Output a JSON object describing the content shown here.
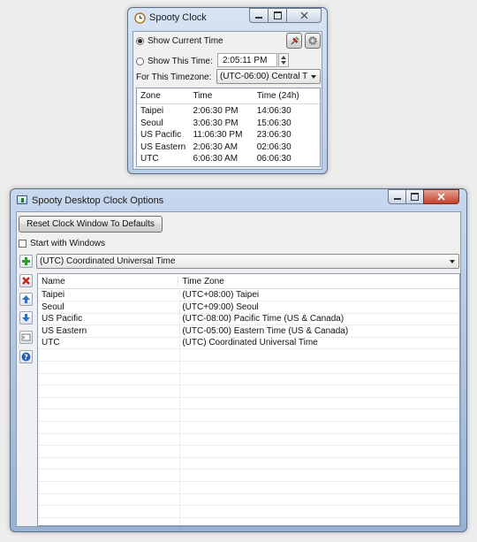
{
  "clock_window": {
    "title": "Spooty Clock",
    "show_current_time_label": "Show Current Time",
    "show_this_time_label": "Show This Time:",
    "this_time_value": "2:05:11 PM",
    "timezone_label": "For This Timezone:",
    "timezone_value": "(UTC-06:00) Central T",
    "pin_icon": "pin-icon",
    "settings_icon": "gear-icon",
    "columns": [
      "Zone",
      "Time",
      "Time (24h)"
    ],
    "rows": [
      {
        "zone": "Taipei",
        "time": "2:06:30 PM",
        "time24": "14:06:30"
      },
      {
        "zone": "Seoul",
        "time": "3:06:30 PM",
        "time24": "15:06:30"
      },
      {
        "zone": "US Pacific",
        "time": "11:06:30 PM",
        "time24": "23:06:30"
      },
      {
        "zone": "US Eastern",
        "time": "2:06:30 AM",
        "time24": "02:06:30"
      },
      {
        "zone": "UTC",
        "time": "6:06:30 AM",
        "time24": "06:06:30"
      }
    ]
  },
  "options_window": {
    "title": "Spooty Desktop Clock Options",
    "reset_button_label": "Reset Clock Window To Defaults",
    "start_with_windows_label": "Start with Windows",
    "timezone_select_value": "(UTC) Coordinated Universal Time",
    "side_buttons": [
      "add-icon",
      "delete-icon",
      "move-up-icon",
      "move-down-icon",
      "rename-icon",
      "help-icon"
    ],
    "columns": [
      "Name",
      "Time Zone"
    ],
    "rows": [
      {
        "name": "Taipei",
        "zone": "(UTC+08:00) Taipei"
      },
      {
        "name": "Seoul",
        "zone": "(UTC+09:00) Seoul"
      },
      {
        "name": "US Pacific",
        "zone": "(UTC-08:00) Pacific Time (US & Canada)"
      },
      {
        "name": "US Eastern",
        "zone": "(UTC-05:00) Eastern Time (US & Canada)"
      },
      {
        "name": "UTC",
        "zone": "(UTC) Coordinated Universal Time"
      }
    ]
  },
  "colors": {
    "frame": "#b9cde6",
    "client": "#f0f0f0",
    "close_button": "#c2402a",
    "add_green": "#2f9a2f",
    "delete_red": "#c8271d",
    "arrow_blue": "#2f6fc0"
  }
}
